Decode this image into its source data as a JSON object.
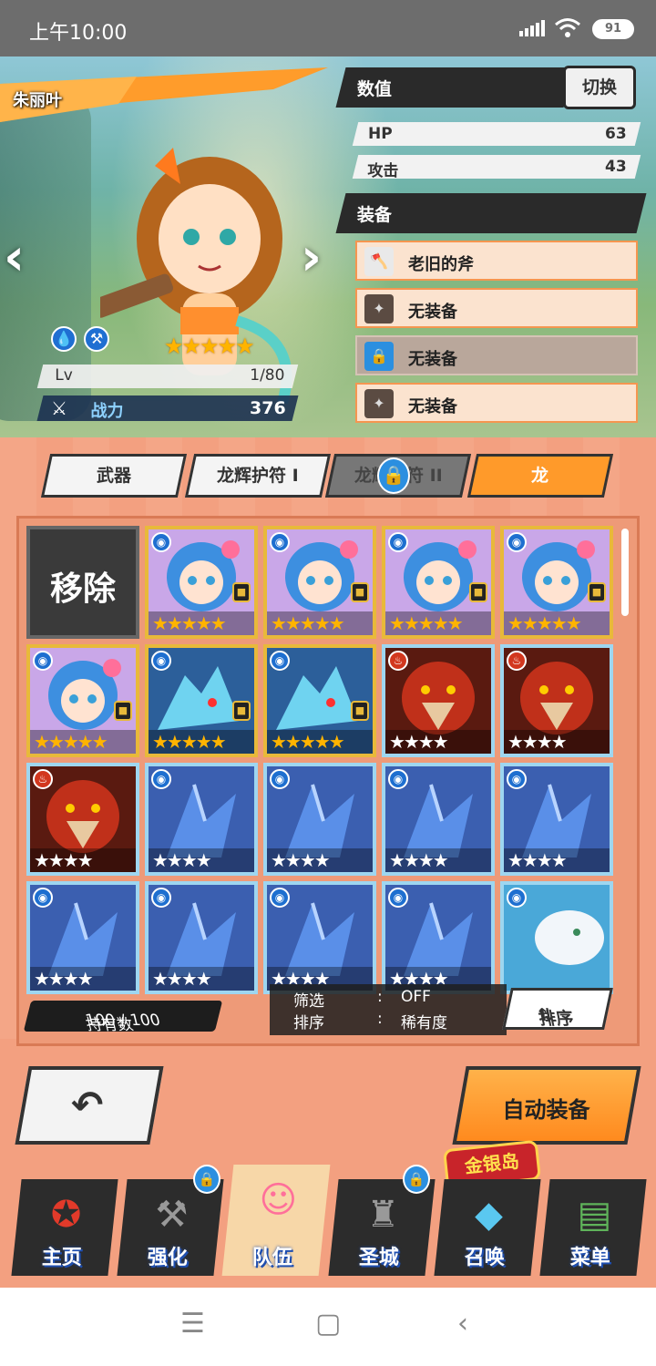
{
  "status_bar": {
    "time": "上午10:00",
    "battery": "91"
  },
  "hero": {
    "character_name": "朱丽叶",
    "rarity_stars": "★★★★★",
    "level_label": "Lv",
    "level_value": "1/80",
    "power_label": "战力",
    "power_value": "376"
  },
  "stats_panel": {
    "title": "数值",
    "switch_label": "切换",
    "stats": [
      {
        "label": "HP",
        "value": "63"
      },
      {
        "label": "攻击",
        "value": "43"
      }
    ]
  },
  "equipment_panel": {
    "title": "装备",
    "slots": [
      {
        "label": "老旧的斧",
        "icon": "axe-icon"
      },
      {
        "label": "无装备",
        "icon": "empty-slot-icon"
      },
      {
        "label": "无装备",
        "icon": "lock-icon"
      },
      {
        "label": "无装备",
        "icon": "empty-slot-icon"
      }
    ]
  },
  "tabs": [
    {
      "label": "武器",
      "state": "normal"
    },
    {
      "label": "龙辉护符 I",
      "state": "normal"
    },
    {
      "label": "龙辉护符 II",
      "state": "locked"
    },
    {
      "label": "龙",
      "state": "active"
    }
  ],
  "grid": {
    "remove_label": "移除",
    "cards": [
      {
        "type": "girl",
        "element": "water",
        "stars": "★★★★★",
        "locked": true
      },
      {
        "type": "girl",
        "element": "water",
        "stars": "★★★★★",
        "locked": true
      },
      {
        "type": "girl",
        "element": "water",
        "stars": "★★★★★",
        "locked": true
      },
      {
        "type": "girl",
        "element": "water",
        "stars": "★★★★★",
        "locked": true
      },
      {
        "type": "girl",
        "element": "water",
        "stars": "★★★★★",
        "locked": true
      },
      {
        "type": "ice-dragon",
        "element": "water",
        "stars": "★★★★★",
        "locked": true
      },
      {
        "type": "ice-dragon",
        "element": "water",
        "stars": "★★★★★",
        "locked": true
      },
      {
        "type": "fire-beast",
        "element": "fire",
        "stars": "★★★★",
        "locked": false
      },
      {
        "type": "fire-beast",
        "element": "fire",
        "stars": "★★★★",
        "locked": false
      },
      {
        "type": "fire-beast",
        "element": "fire",
        "stars": "★★★★",
        "locked": false
      },
      {
        "type": "blue-dragon",
        "element": "water",
        "stars": "★★★★",
        "locked": false
      },
      {
        "type": "blue-dragon",
        "element": "water",
        "stars": "★★★★",
        "locked": false
      },
      {
        "type": "blue-dragon",
        "element": "water",
        "stars": "★★★★",
        "locked": false
      },
      {
        "type": "blue-dragon",
        "element": "water",
        "stars": "★★★★",
        "locked": false
      },
      {
        "type": "blue-dragon",
        "element": "water",
        "stars": "★★★★",
        "locked": false
      },
      {
        "type": "blue-dragon",
        "element": "water",
        "stars": "★★★★",
        "locked": false
      },
      {
        "type": "blue-dragon",
        "element": "water",
        "stars": "★★★★",
        "locked": false
      },
      {
        "type": "blue-dragon",
        "element": "water",
        "stars": "★★★★",
        "locked": false
      },
      {
        "type": "white-dragon",
        "element": "water",
        "stars": "",
        "locked": false
      }
    ]
  },
  "owned": {
    "label": "持有数",
    "value": "100 / 100"
  },
  "filter": {
    "filter_label": "筛选",
    "filter_value": "OFF",
    "sort_label": "排序",
    "sort_value": "稀有度",
    "separator": ":"
  },
  "sort_button": "排序",
  "actions": {
    "auto_equip": "自动装备"
  },
  "bottom_nav": {
    "event_banner": "金银岛",
    "items": [
      {
        "label": "主页",
        "icon": "home-emblem-icon",
        "locked": false
      },
      {
        "label": "强化",
        "icon": "hammer-icon",
        "locked": true
      },
      {
        "label": "队伍",
        "icon": "team-icon",
        "locked": false
      },
      {
        "label": "圣城",
        "icon": "castle-icon",
        "locked": true
      },
      {
        "label": "召唤",
        "icon": "crystal-icon",
        "locked": false
      },
      {
        "label": "菜单",
        "icon": "book-icon",
        "locked": false
      }
    ]
  },
  "system_nav": {
    "menu": "☰",
    "home": "▢",
    "back": "‹"
  }
}
